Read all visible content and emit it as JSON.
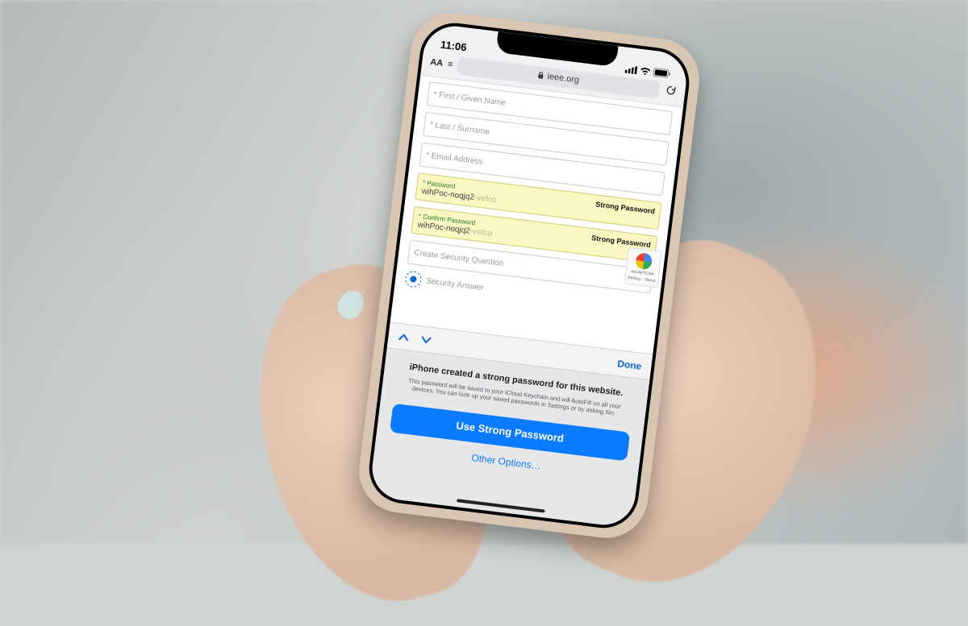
{
  "status": {
    "time": "11:06"
  },
  "safari": {
    "text_size_label": "AA",
    "domain": "ieee.org"
  },
  "form": {
    "first_name_placeholder": "* First / Given Name",
    "last_name_placeholder": "* Last / Surname",
    "email_placeholder": "* Email Address",
    "password_mini_label": "* Password",
    "password_value": "wihPoc-noqjq2",
    "password_value_suffix": "-vefco",
    "strong_label": "Strong Password",
    "confirm_mini_label": "* Confirm Password",
    "security_q_placeholder": "Create Security Question",
    "security_a_placeholder": "Security Answer",
    "recaptcha_label": "reCAPTCHA",
    "recaptcha_sub": "Privacy - Terms"
  },
  "accessory": {
    "done": "Done"
  },
  "sheet": {
    "title": "iPhone created a strong password for this website.",
    "body": "This password will be saved to your iCloud Keychain and will AutoFill on all your devices. You can look up your saved passwords in Settings or by asking Siri.",
    "primary": "Use Strong Password",
    "secondary": "Other Options…"
  }
}
